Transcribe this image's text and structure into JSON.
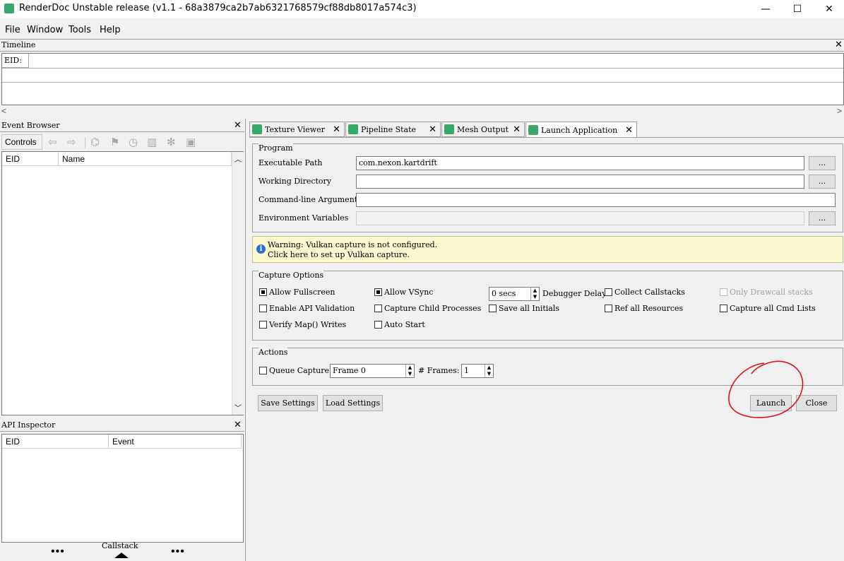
{
  "window": {
    "title": "RenderDoc Unstable release (v1.1 - 68a3879ca2b7ab6321768579cf88db8017a574c3)",
    "minimize_glyph": "—",
    "maximize_glyph": "☐",
    "close_glyph": "✕"
  },
  "menu": [
    "File",
    "Window",
    "Tools",
    "Help"
  ],
  "timeline": {
    "title": "Timeline",
    "eid_label": "EID:",
    "close_glyph": "✕",
    "scroll_left": "<",
    "scroll_right": ">"
  },
  "event_browser": {
    "title": "Event Browser",
    "controls_label": "Controls",
    "columns": [
      "EID",
      "Name"
    ],
    "toolbar_icons": [
      "arrow-left-icon",
      "arrow-right-icon",
      "binoculars-icon",
      "flag-icon",
      "clock-icon",
      "timeline-bars-icon",
      "asterisk-icon",
      "save-icon"
    ]
  },
  "api_inspector": {
    "title": "API Inspector",
    "columns": [
      "EID",
      "Event"
    ],
    "callstack_label": "Callstack",
    "dots": "•••"
  },
  "tabs": [
    {
      "label": "Texture Viewer",
      "active": false
    },
    {
      "label": "Pipeline State",
      "active": false
    },
    {
      "label": "Mesh Output",
      "active": false
    },
    {
      "label": "Launch Application",
      "active": true
    }
  ],
  "program": {
    "title": "Program",
    "executable_label": "Executable Path",
    "executable_value": "com.nexon.kartdrift",
    "working_dir_label": "Working Directory",
    "working_dir_value": "",
    "cmdline_label": "Command-line Arguments",
    "cmdline_value": "",
    "env_label": "Environment Variables",
    "browse_label": "..."
  },
  "warning": {
    "line1": "Warning: Vulkan capture is not configured.",
    "line2": "Click here to set up Vulkan capture."
  },
  "capture_options": {
    "title": "Capture Options",
    "allow_fullscreen": "Allow Fullscreen",
    "allow_vsync": "Allow VSync",
    "delay_value": "0 secs",
    "debugger_delay": "Debugger Delay",
    "collect_callstacks": "Collect Callstacks",
    "only_drawcall_stacks": "Only Drawcall stacks",
    "enable_api_validation": "Enable API Validation",
    "capture_child_processes": "Capture Child Processes",
    "save_all_initials": "Save all Initials",
    "ref_all_resources": "Ref all Resources",
    "capture_all_cmd_lists": "Capture all Cmd Lists",
    "verify_map_writes": "Verify Map() Writes",
    "auto_start": "Auto Start"
  },
  "actions": {
    "title": "Actions",
    "queue_capture": "Queue Capture",
    "frame_value": "Frame 0",
    "frames_label": "# Frames:",
    "frames_value": "1"
  },
  "buttons": {
    "save_settings": "Save Settings",
    "load_settings": "Load Settings",
    "launch": "Launch",
    "close": "Close"
  },
  "colors": {
    "annotation_red": "#e0101a",
    "warning_bg": "#fcf8d0",
    "tab_icon": "#3aa86b"
  }
}
